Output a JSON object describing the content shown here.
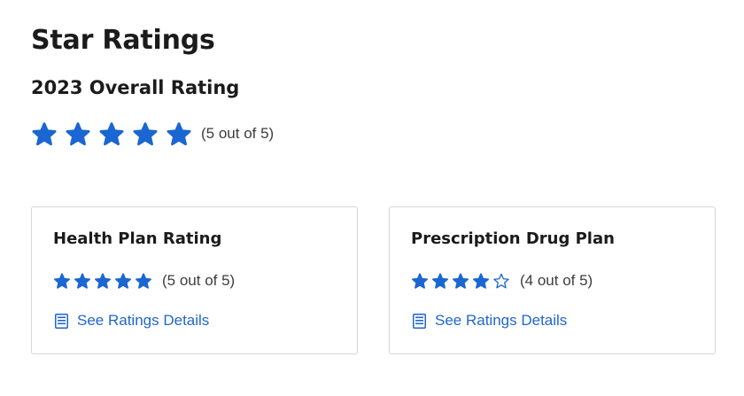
{
  "page": {
    "title": "Star Ratings"
  },
  "overall": {
    "heading": "2023 Overall Rating",
    "rating": 5,
    "max_rating": 5,
    "rating_text": "(5 out of 5)"
  },
  "cards": [
    {
      "title": "Health Plan Rating",
      "rating": 5,
      "max_rating": 5,
      "rating_text": "(5 out of 5)",
      "link_label": "See Ratings Details",
      "link_icon": "document-list-icon"
    },
    {
      "title": "Prescription Drug Plan",
      "rating": 4,
      "max_rating": 5,
      "rating_text": "(4 out of 5)",
      "link_label": "See Ratings Details",
      "link_icon": "document-list-icon"
    }
  ],
  "colors": {
    "star": "#1a66d2",
    "link": "#1f66cc",
    "card_border": "#d6d6d6",
    "heading": "#1b1b1b",
    "muted_text": "#3d3d3d"
  },
  "icons": {
    "filled_star": "star-filled-icon",
    "empty_star": "star-outline-icon",
    "details": "document-list-icon"
  }
}
